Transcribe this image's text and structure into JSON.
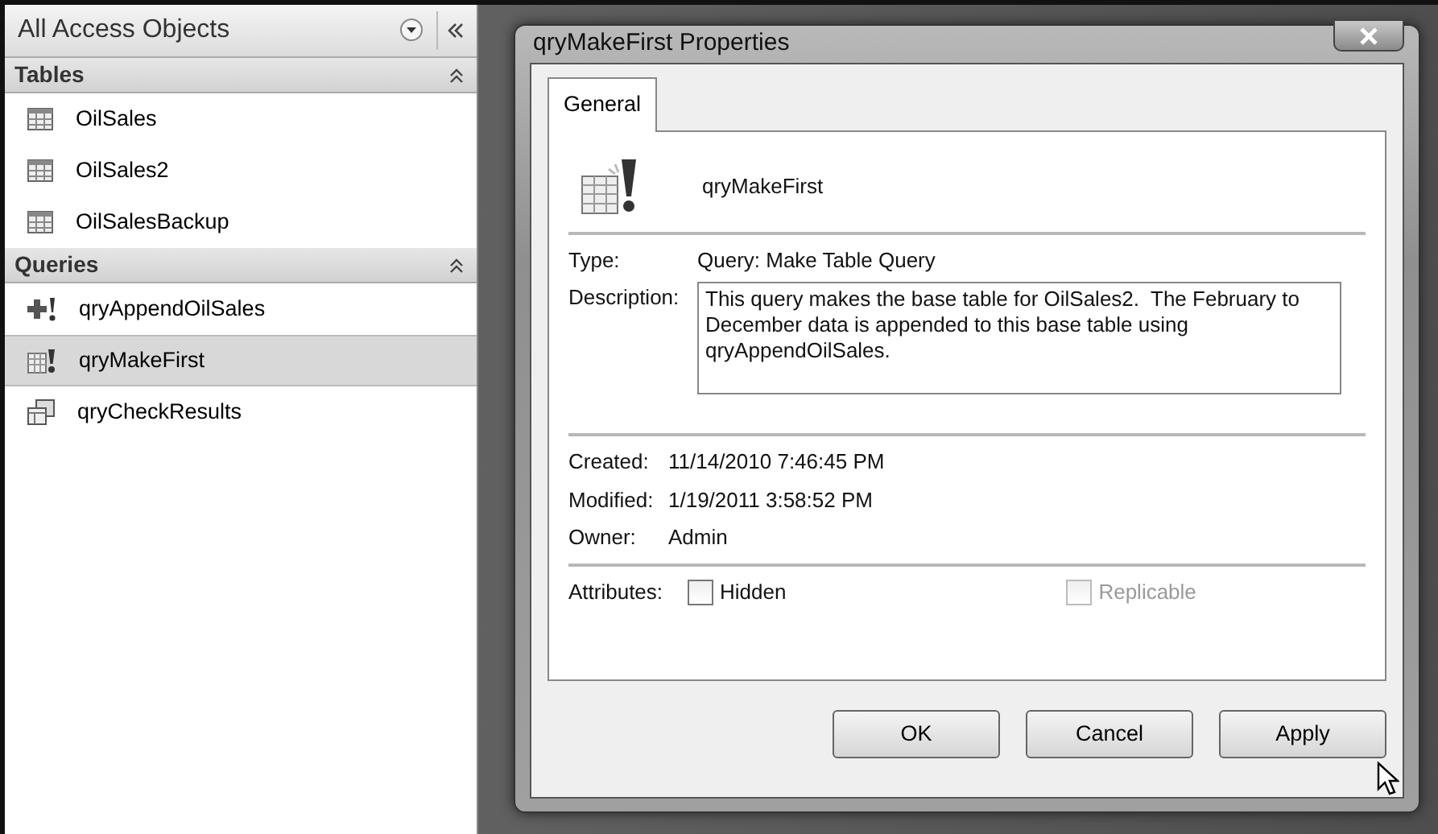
{
  "navigation_pane": {
    "title": "All Access Objects",
    "groups": [
      {
        "label": "Tables",
        "expanded": true,
        "items": [
          {
            "label": "OilSales",
            "kind": "table",
            "selected": false
          },
          {
            "label": "OilSales2",
            "kind": "table",
            "selected": false
          },
          {
            "label": "OilSalesBackup",
            "kind": "table",
            "selected": false
          }
        ]
      },
      {
        "label": "Queries",
        "expanded": true,
        "items": [
          {
            "label": "qryAppendOilSales",
            "kind": "append",
            "selected": false
          },
          {
            "label": "qryMakeFirst",
            "kind": "make-table",
            "selected": true
          },
          {
            "label": "qryCheckResults",
            "kind": "select",
            "selected": false
          }
        ]
      }
    ]
  },
  "dialog": {
    "title": "qryMakeFirst Properties",
    "tabs": [
      {
        "label": "General",
        "selected": true
      }
    ],
    "object_name": "qryMakeFirst",
    "type": {
      "label": "Type:",
      "value": "Query: Make Table Query"
    },
    "description": {
      "label": "Description:",
      "value": "This query makes the base table for OilSales2.  The February to December data is appended to this base table using qryAppendOilSales."
    },
    "info": [
      {
        "label": "Created:",
        "value": "11/14/2010 7:46:45 PM"
      },
      {
        "label": "Modified:",
        "value": "1/19/2011 3:58:52 PM"
      },
      {
        "label": "Owner:",
        "value": "Admin"
      }
    ],
    "attributes": {
      "label": "Attributes:",
      "options": [
        {
          "label": "Hidden",
          "checked": false,
          "disabled": false
        },
        {
          "label": "Replicable",
          "checked": false,
          "disabled": true
        }
      ]
    },
    "buttons": [
      {
        "label": "OK"
      },
      {
        "label": "Cancel"
      },
      {
        "label": "Apply"
      }
    ]
  }
}
